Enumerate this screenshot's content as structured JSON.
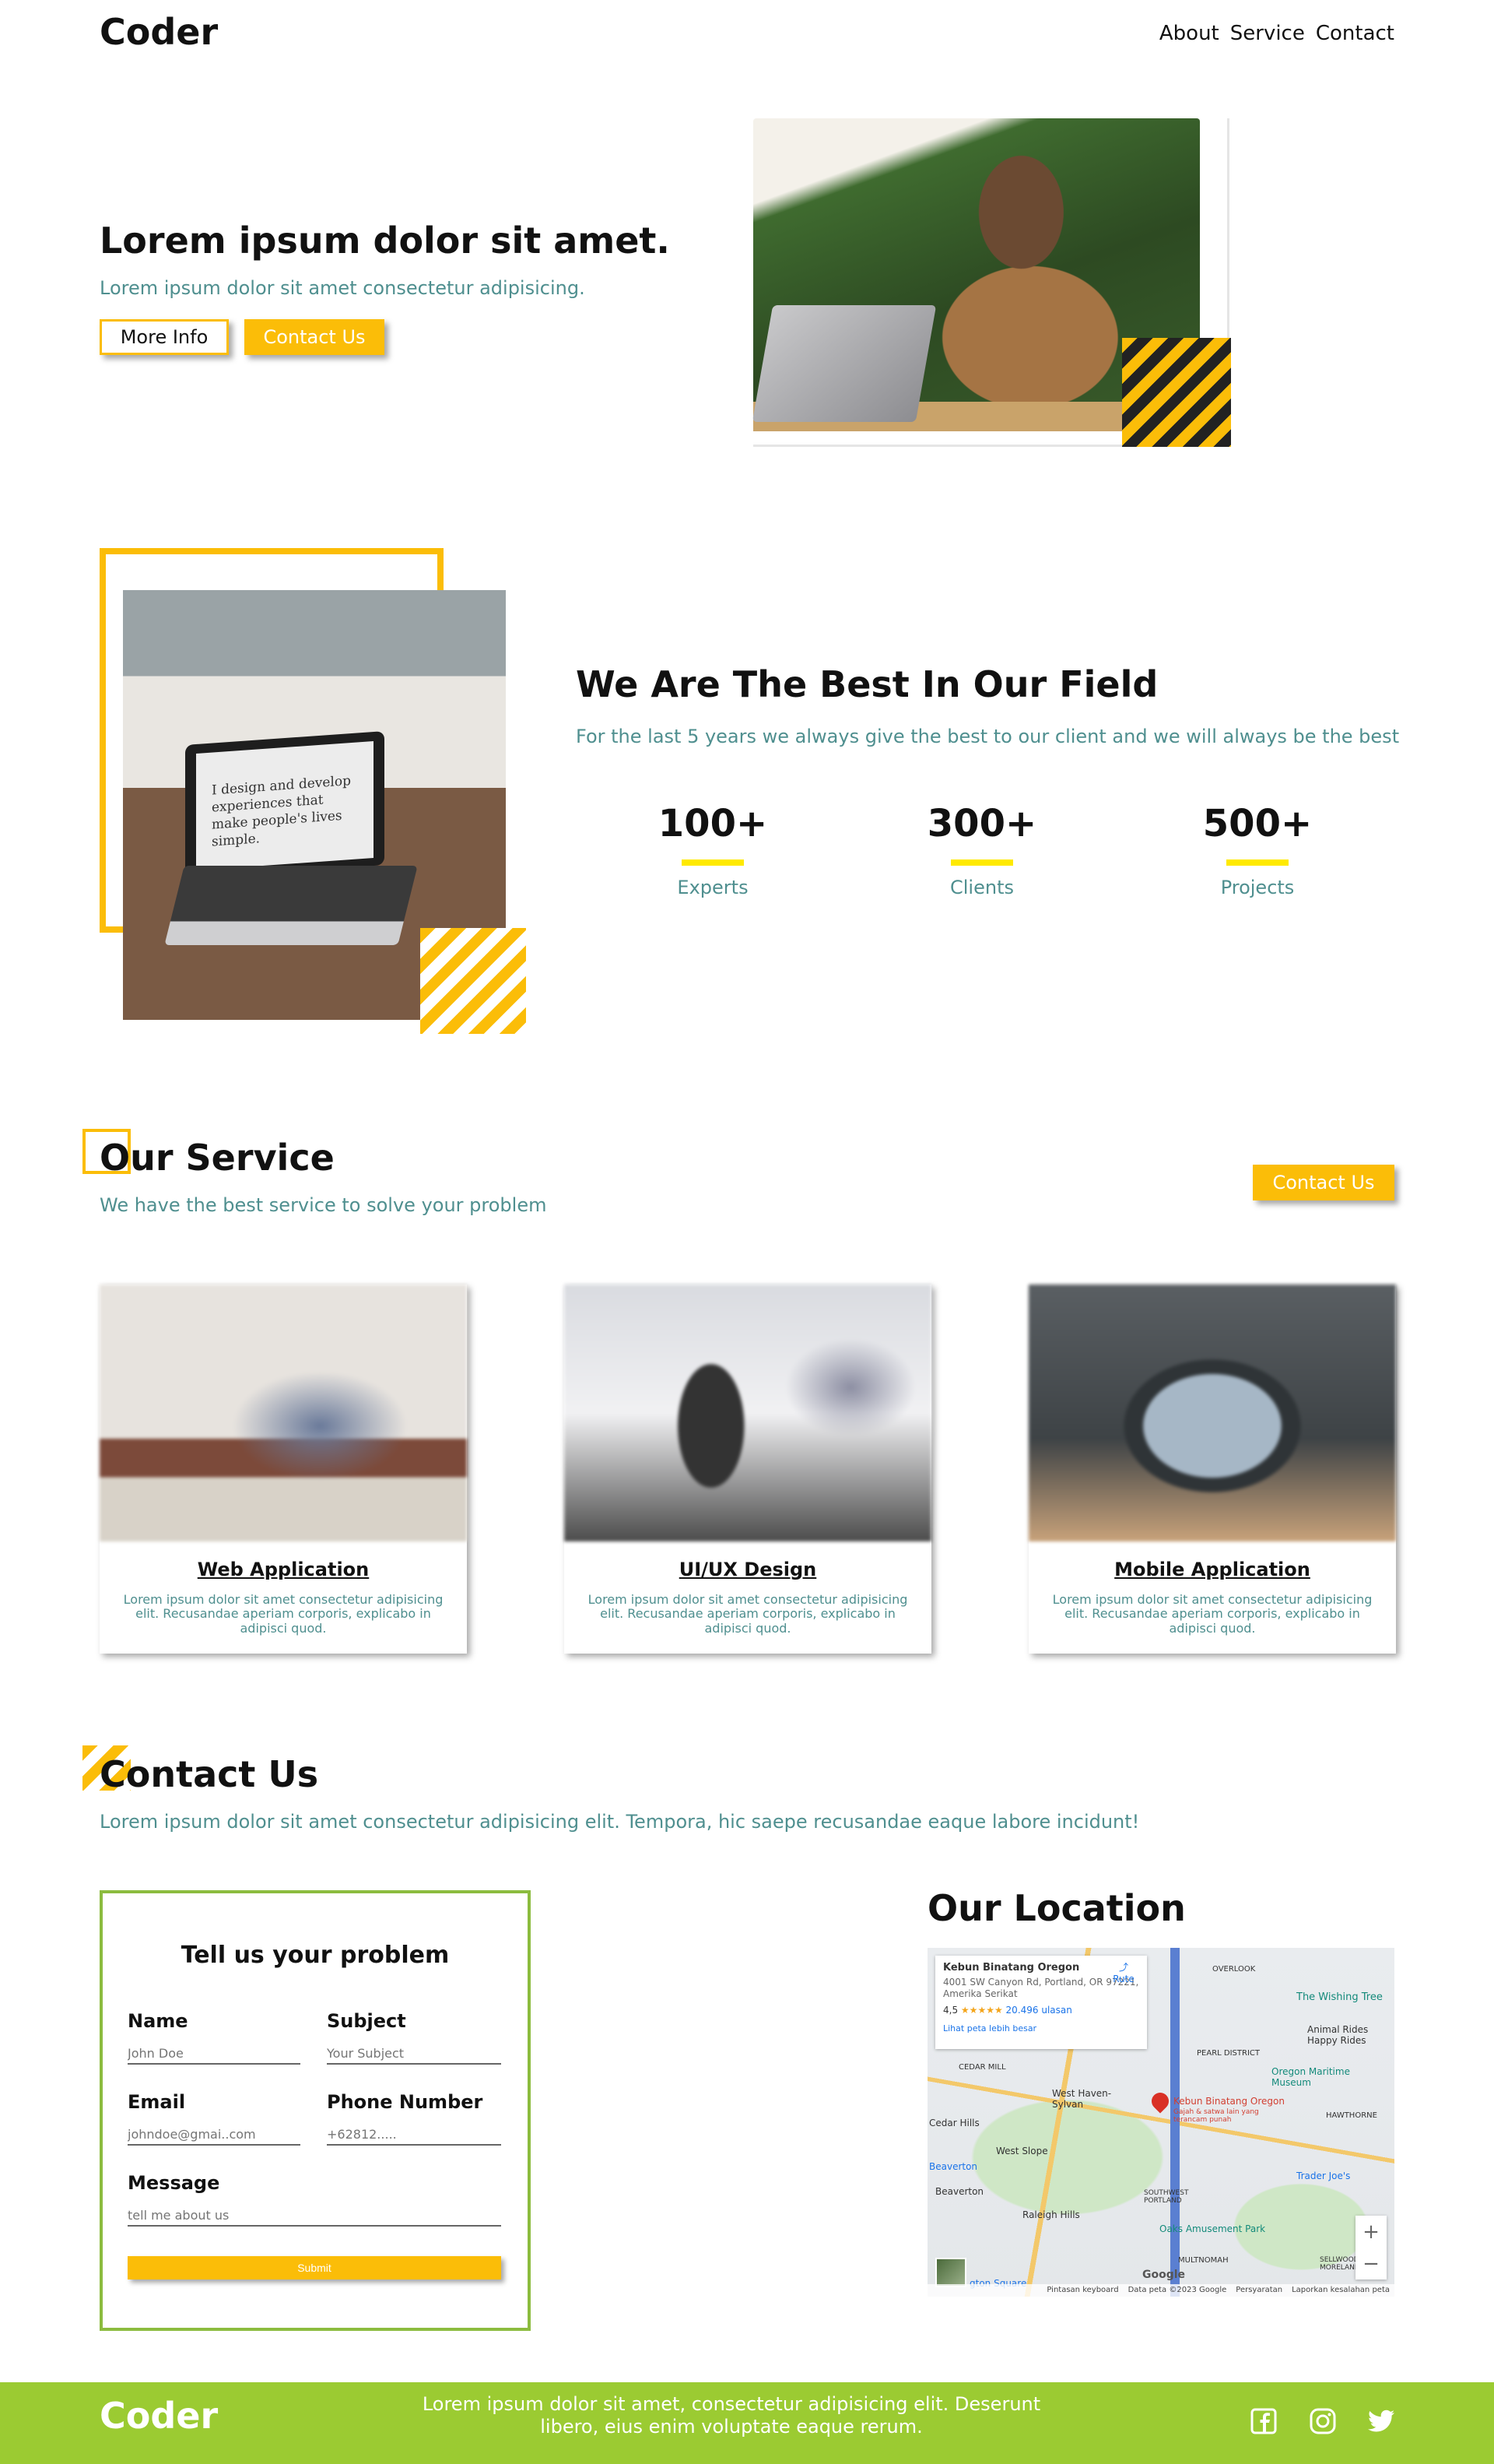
{
  "header": {
    "logo": "Coder",
    "nav": [
      "About",
      "Service",
      "Contact"
    ]
  },
  "hero": {
    "title": "Lorem ipsum dolor sit amet.",
    "subtitle": "Lorem ipsum dolor sit amet consectetur adipisicing.",
    "more_info_label": "More Info",
    "contact_label": "Contact Us"
  },
  "about": {
    "laptop_text": "I design and develop experiences that make people's lives simple.",
    "title": "We Are The Best In Our Field",
    "subtitle": "For the last 5 years we always give the best to our client and we will always be the best",
    "stats": [
      {
        "value": "100+",
        "label": "Experts"
      },
      {
        "value": "300+",
        "label": "Clients"
      },
      {
        "value": "500+",
        "label": "Projects"
      }
    ]
  },
  "service": {
    "title": "Our Service",
    "subtitle": "We have the best service to solve your problem",
    "button_label": "Contact Us",
    "cards": [
      {
        "title": "Web Application",
        "desc": "Lorem ipsum dolor sit amet consectetur adipisicing elit. Recusandae aperiam corporis, explicabo in adipisci quod."
      },
      {
        "title": "UI/UX Design",
        "desc": "Lorem ipsum dolor sit amet consectetur adipisicing elit. Recusandae aperiam corporis, explicabo in adipisci quod."
      },
      {
        "title": "Mobile Application",
        "desc": "Lorem ipsum dolor sit amet consectetur adipisicing elit. Recusandae aperiam corporis, explicabo in adipisci quod."
      }
    ]
  },
  "contact": {
    "title": "Contact Us",
    "subtitle": "Lorem ipsum dolor sit amet consectetur adipisicing elit. Tempora, hic saepe recusandae eaque labore incidunt!",
    "form": {
      "title": "Tell us your problem",
      "name_label": "Name",
      "name_placeholder": "John Doe",
      "subject_label": "Subject",
      "subject_placeholder": "Your Subject",
      "email_label": "Email",
      "email_placeholder": "johndoe@gmai..com",
      "phone_label": "Phone Number",
      "phone_placeholder": "+62812.....",
      "message_label": "Message",
      "message_placeholder": "tell me about us",
      "submit_label": "Submit"
    }
  },
  "location": {
    "title": "Our Location",
    "card": {
      "name": "Kebun Binatang Oregon",
      "address": "4001 SW Canyon Rd, Portland, OR 97221, Amerika Serikat",
      "rating": "4,5",
      "stars": "★★★★★",
      "reviews": "20.496 ulasan",
      "link": "Lihat peta lebih besar",
      "route": "Rute"
    },
    "labels": {
      "overlook": "OVERLOOK",
      "wishing_tree": "The Wishing Tree",
      "animal_rides": "Animal Rides Happy Rides",
      "pearl": "PEARL DISTRICT",
      "cedar_mill": "CEDAR MILL",
      "omsi": "Oregon Maritime Museum",
      "west_haven": "West Haven-Sylvan",
      "cedar_hills": "Cedar Hills",
      "zoo": "Kebun Binatang Oregon",
      "zoo_sub": "Gajah & satwa lain yang terancam punah",
      "hawthorne": "HAWTHORNE",
      "west_slope": "West Slope",
      "beaverton_loc": "Beaverton",
      "trader_joes": "Trader Joe's",
      "beaverton": "Beaverton",
      "sw_portland": "SOUTHWEST PORTLAND",
      "raleigh": "Raleigh Hills",
      "oaks": "Oaks Amusement Park",
      "multnomah": "MULTNOMAH",
      "sellwood": "SELLWOOD MORELAND",
      "washington_sq": "gton Square",
      "google": "Google"
    },
    "footer": [
      "Pintasan keyboard",
      "Data peta ©2023 Google",
      "Persyaratan",
      "Laporkan kesalahan peta"
    ]
  },
  "footer": {
    "logo": "Coder",
    "text": "Lorem ipsum dolor sit amet, consectetur adipisicing elit. Deserunt libero, eius enim voluptate eaque rerum.",
    "icons": [
      "facebook-icon",
      "instagram-icon",
      "twitter-icon"
    ]
  },
  "colors": {
    "accent": "#fbbd08",
    "teal_text": "#4f8f8f",
    "footer_green": "#9bcb32",
    "form_border": "#8cbc3f",
    "stat_bar": "#ffea00"
  }
}
